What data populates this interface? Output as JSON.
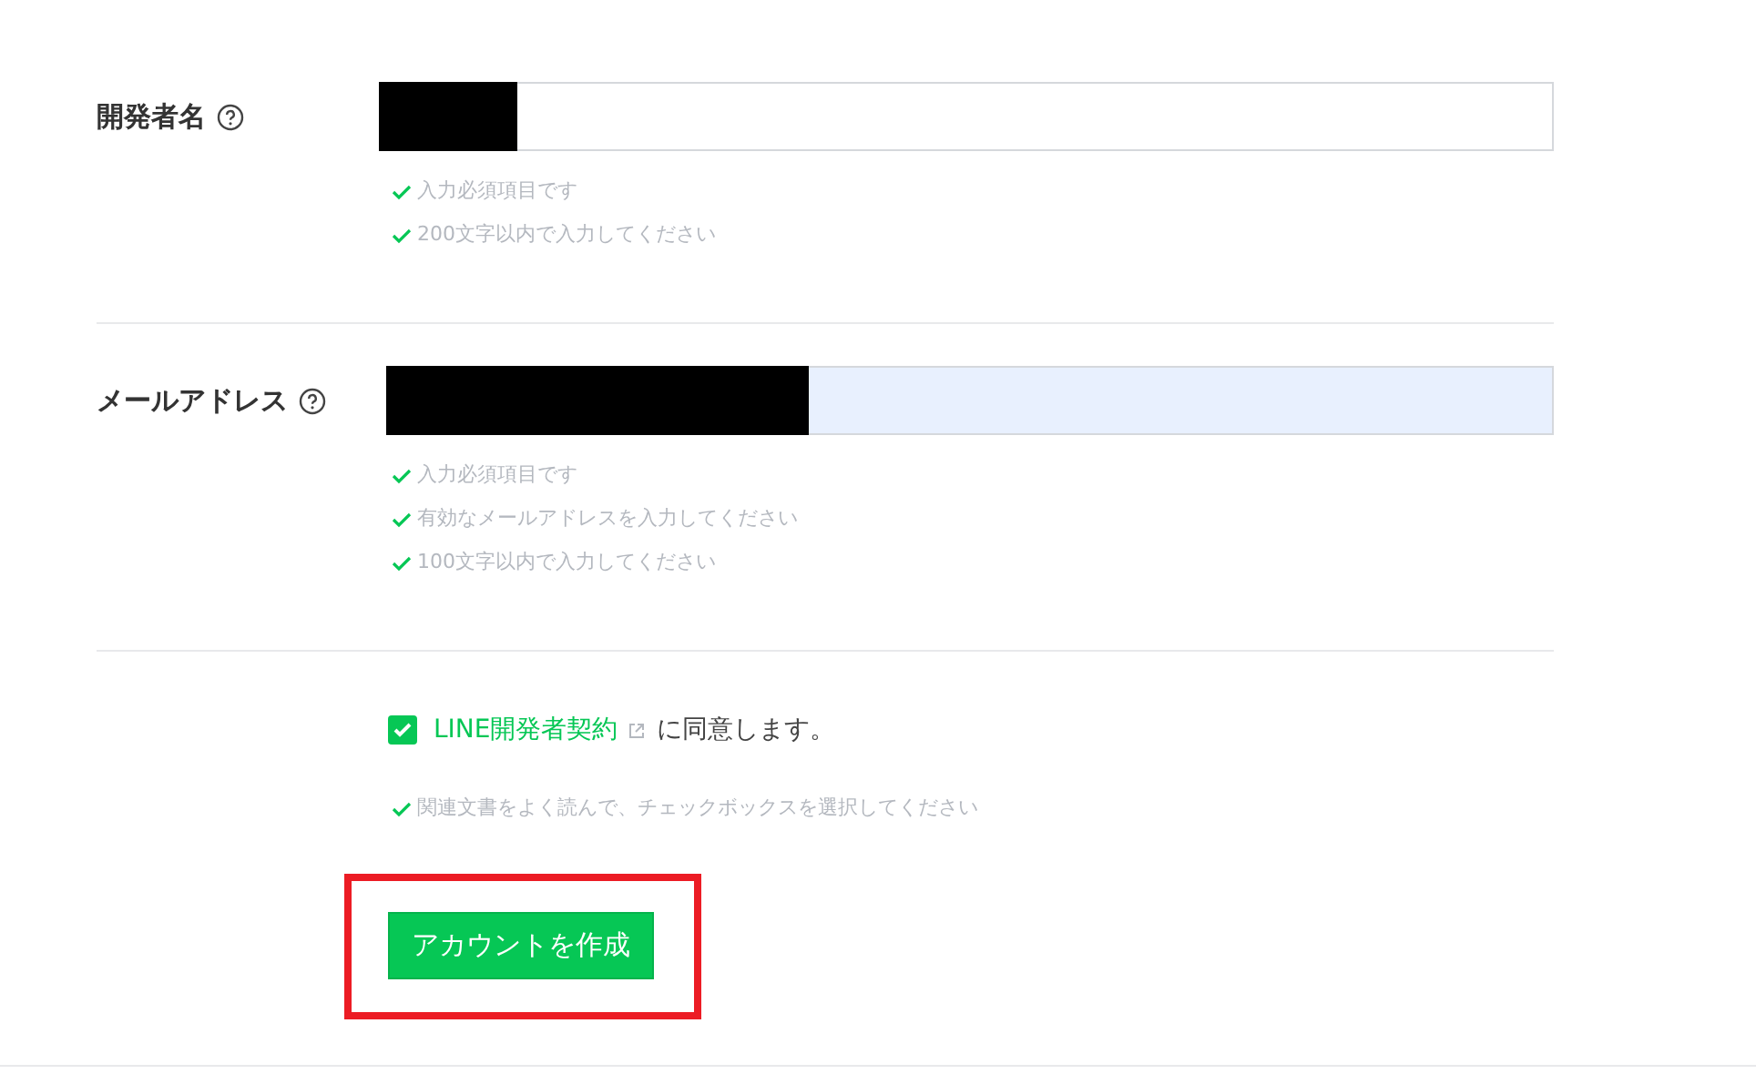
{
  "fields": [
    {
      "label": "開発者名",
      "kind": "text",
      "autofilled": false,
      "value_redacted": true,
      "hints": [
        "入力必須項目です",
        "200文字以内で入力してください"
      ]
    },
    {
      "label": "メールアドレス",
      "kind": "email",
      "autofilled": true,
      "value_redacted": true,
      "hints": [
        "入力必須項目です",
        "有効なメールアドレスを入力してください",
        "100文字以内で入力してください"
      ]
    }
  ],
  "agreement": {
    "checked": true,
    "link": "LINE開発者契約",
    "text": "に同意します。",
    "hint": "関連文書をよく読んで、チェックボックスを選択してください"
  },
  "submit": {
    "label": "アカウントを作成",
    "highlighted": true
  }
}
